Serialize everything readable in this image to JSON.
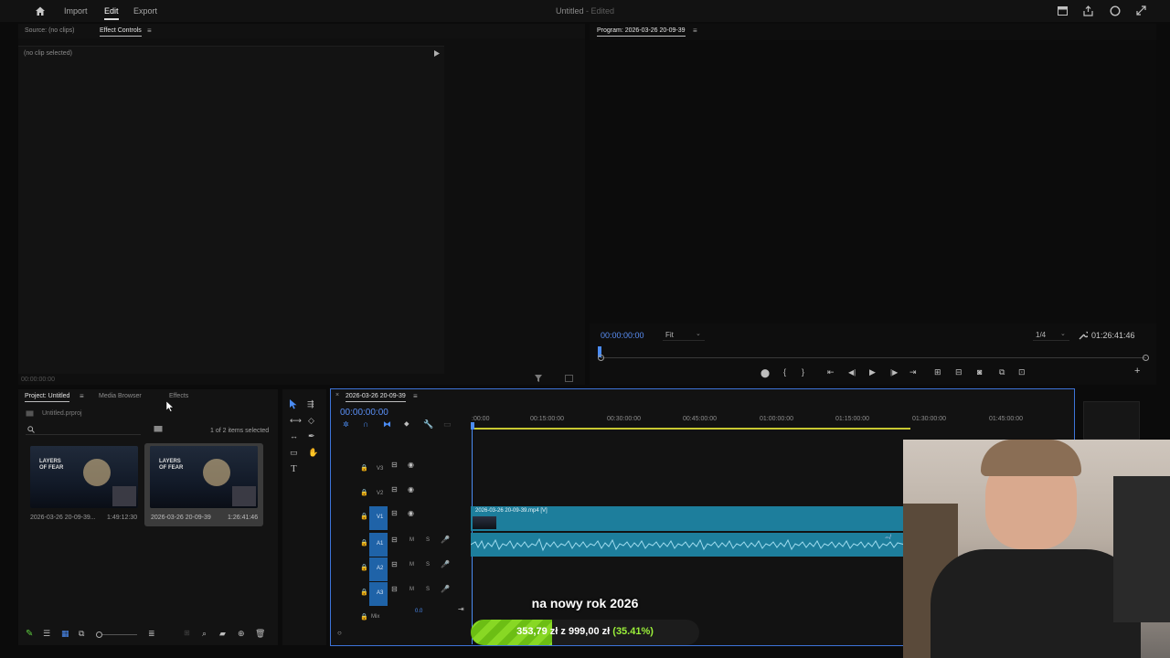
{
  "topbar": {
    "home_icon": "home-icon",
    "nav": [
      "Import",
      "Edit",
      "Export"
    ],
    "active_nav": "Edit",
    "doc_title": "Untitled",
    "doc_status": "- Edited",
    "right_icons": [
      "workspaces-icon",
      "share-icon",
      "notifications-icon",
      "fullscreen-icon"
    ]
  },
  "source_panel": {
    "tabs": [
      "Source: (no clips)",
      "Effect Controls"
    ],
    "active_tab": "Effect Controls",
    "message": "(no clip selected)",
    "timecode": "00:00:00:00"
  },
  "program_panel": {
    "title": "Program: 2026-03-26 20-09-39",
    "timecode": "00:00:00:00",
    "zoom": "Fit",
    "resolution": "1/4",
    "duration": "01:26:41:46"
  },
  "project_panel": {
    "tabs": [
      "Project: Untitled",
      "Media Browser",
      "Effects"
    ],
    "active_tab": "Project: Untitled",
    "file": "Untitled.prproj",
    "selection": "1 of 2 items selected",
    "items": [
      {
        "name": "2026-03-26 20-09-39...",
        "duration": "1:49:12:30",
        "thumb_text": "LAYERS OF FEAR"
      },
      {
        "name": "2026-03-26 20-09-39",
        "duration": "1:26:41:46",
        "thumb_text": "LAYERS OF FEAR"
      }
    ]
  },
  "timeline": {
    "sequence": "2026-03-26 20-09-39",
    "timecode": "00:00:00:00",
    "ruler": [
      ":00:00",
      "00:15:00:00",
      "00:30:00:00",
      "00:45:00:00",
      "01:00:00:00",
      "01:15:00:00",
      "01:30:00:00",
      "01:45:00:00"
    ],
    "video_tracks": [
      "V3",
      "V2",
      "V1"
    ],
    "audio_tracks": [
      "A1",
      "A2",
      "A3"
    ],
    "mix_label": "Mix",
    "mix_value": "0.0",
    "audio_btn_m": "M",
    "audio_btn_s": "S",
    "clip_label": "2026-03-26 20-09-39.mp4 [V]"
  },
  "overlay": {
    "caption": "na nowy rok 2026",
    "goal_text": "353,79 zł z 999,00 zł",
    "goal_percent_text": "(35.41%)",
    "goal_fraction": 0.3541
  },
  "colors": {
    "accent_blue": "#4b8cf3",
    "clip_teal": "#1d7e9c",
    "goal_green": "#7fcd1e"
  }
}
